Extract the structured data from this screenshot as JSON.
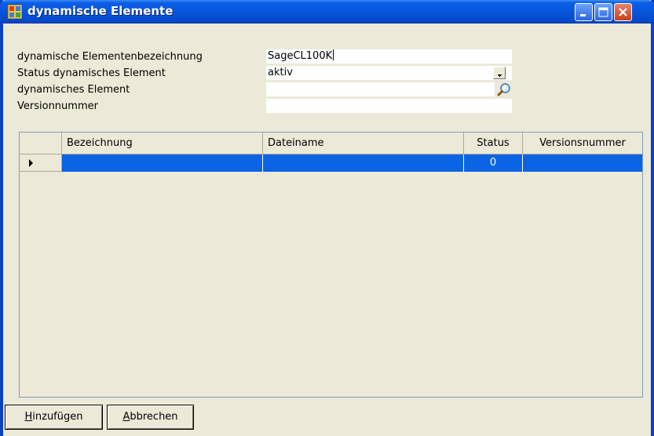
{
  "window": {
    "title": "dynamische Elemente"
  },
  "form": {
    "fields": [
      {
        "label": "dynamische Elementenbezeichnung",
        "value": "SageCL100K"
      },
      {
        "label": "Status dynamisches Element",
        "value": "aktiv"
      },
      {
        "label": "dynamisches Element",
        "value": ""
      },
      {
        "label": "Versionnummer",
        "value": ""
      }
    ]
  },
  "grid": {
    "columns": [
      "Bezeichnung",
      "Dateiname",
      "Status",
      "Versionsnummer"
    ],
    "rows": [
      {
        "bezeichnung": "",
        "dateiname": "",
        "status": "0",
        "versionsnummer": ""
      }
    ]
  },
  "buttons": {
    "add_mnemonic": "H",
    "add_rest": "inzufügen",
    "cancel_mnemonic": "A",
    "cancel_rest": "bbrechen"
  },
  "colors": {
    "title_bar": "#0855dd",
    "selection": "#0a64e3",
    "face": "#ece9d8"
  }
}
